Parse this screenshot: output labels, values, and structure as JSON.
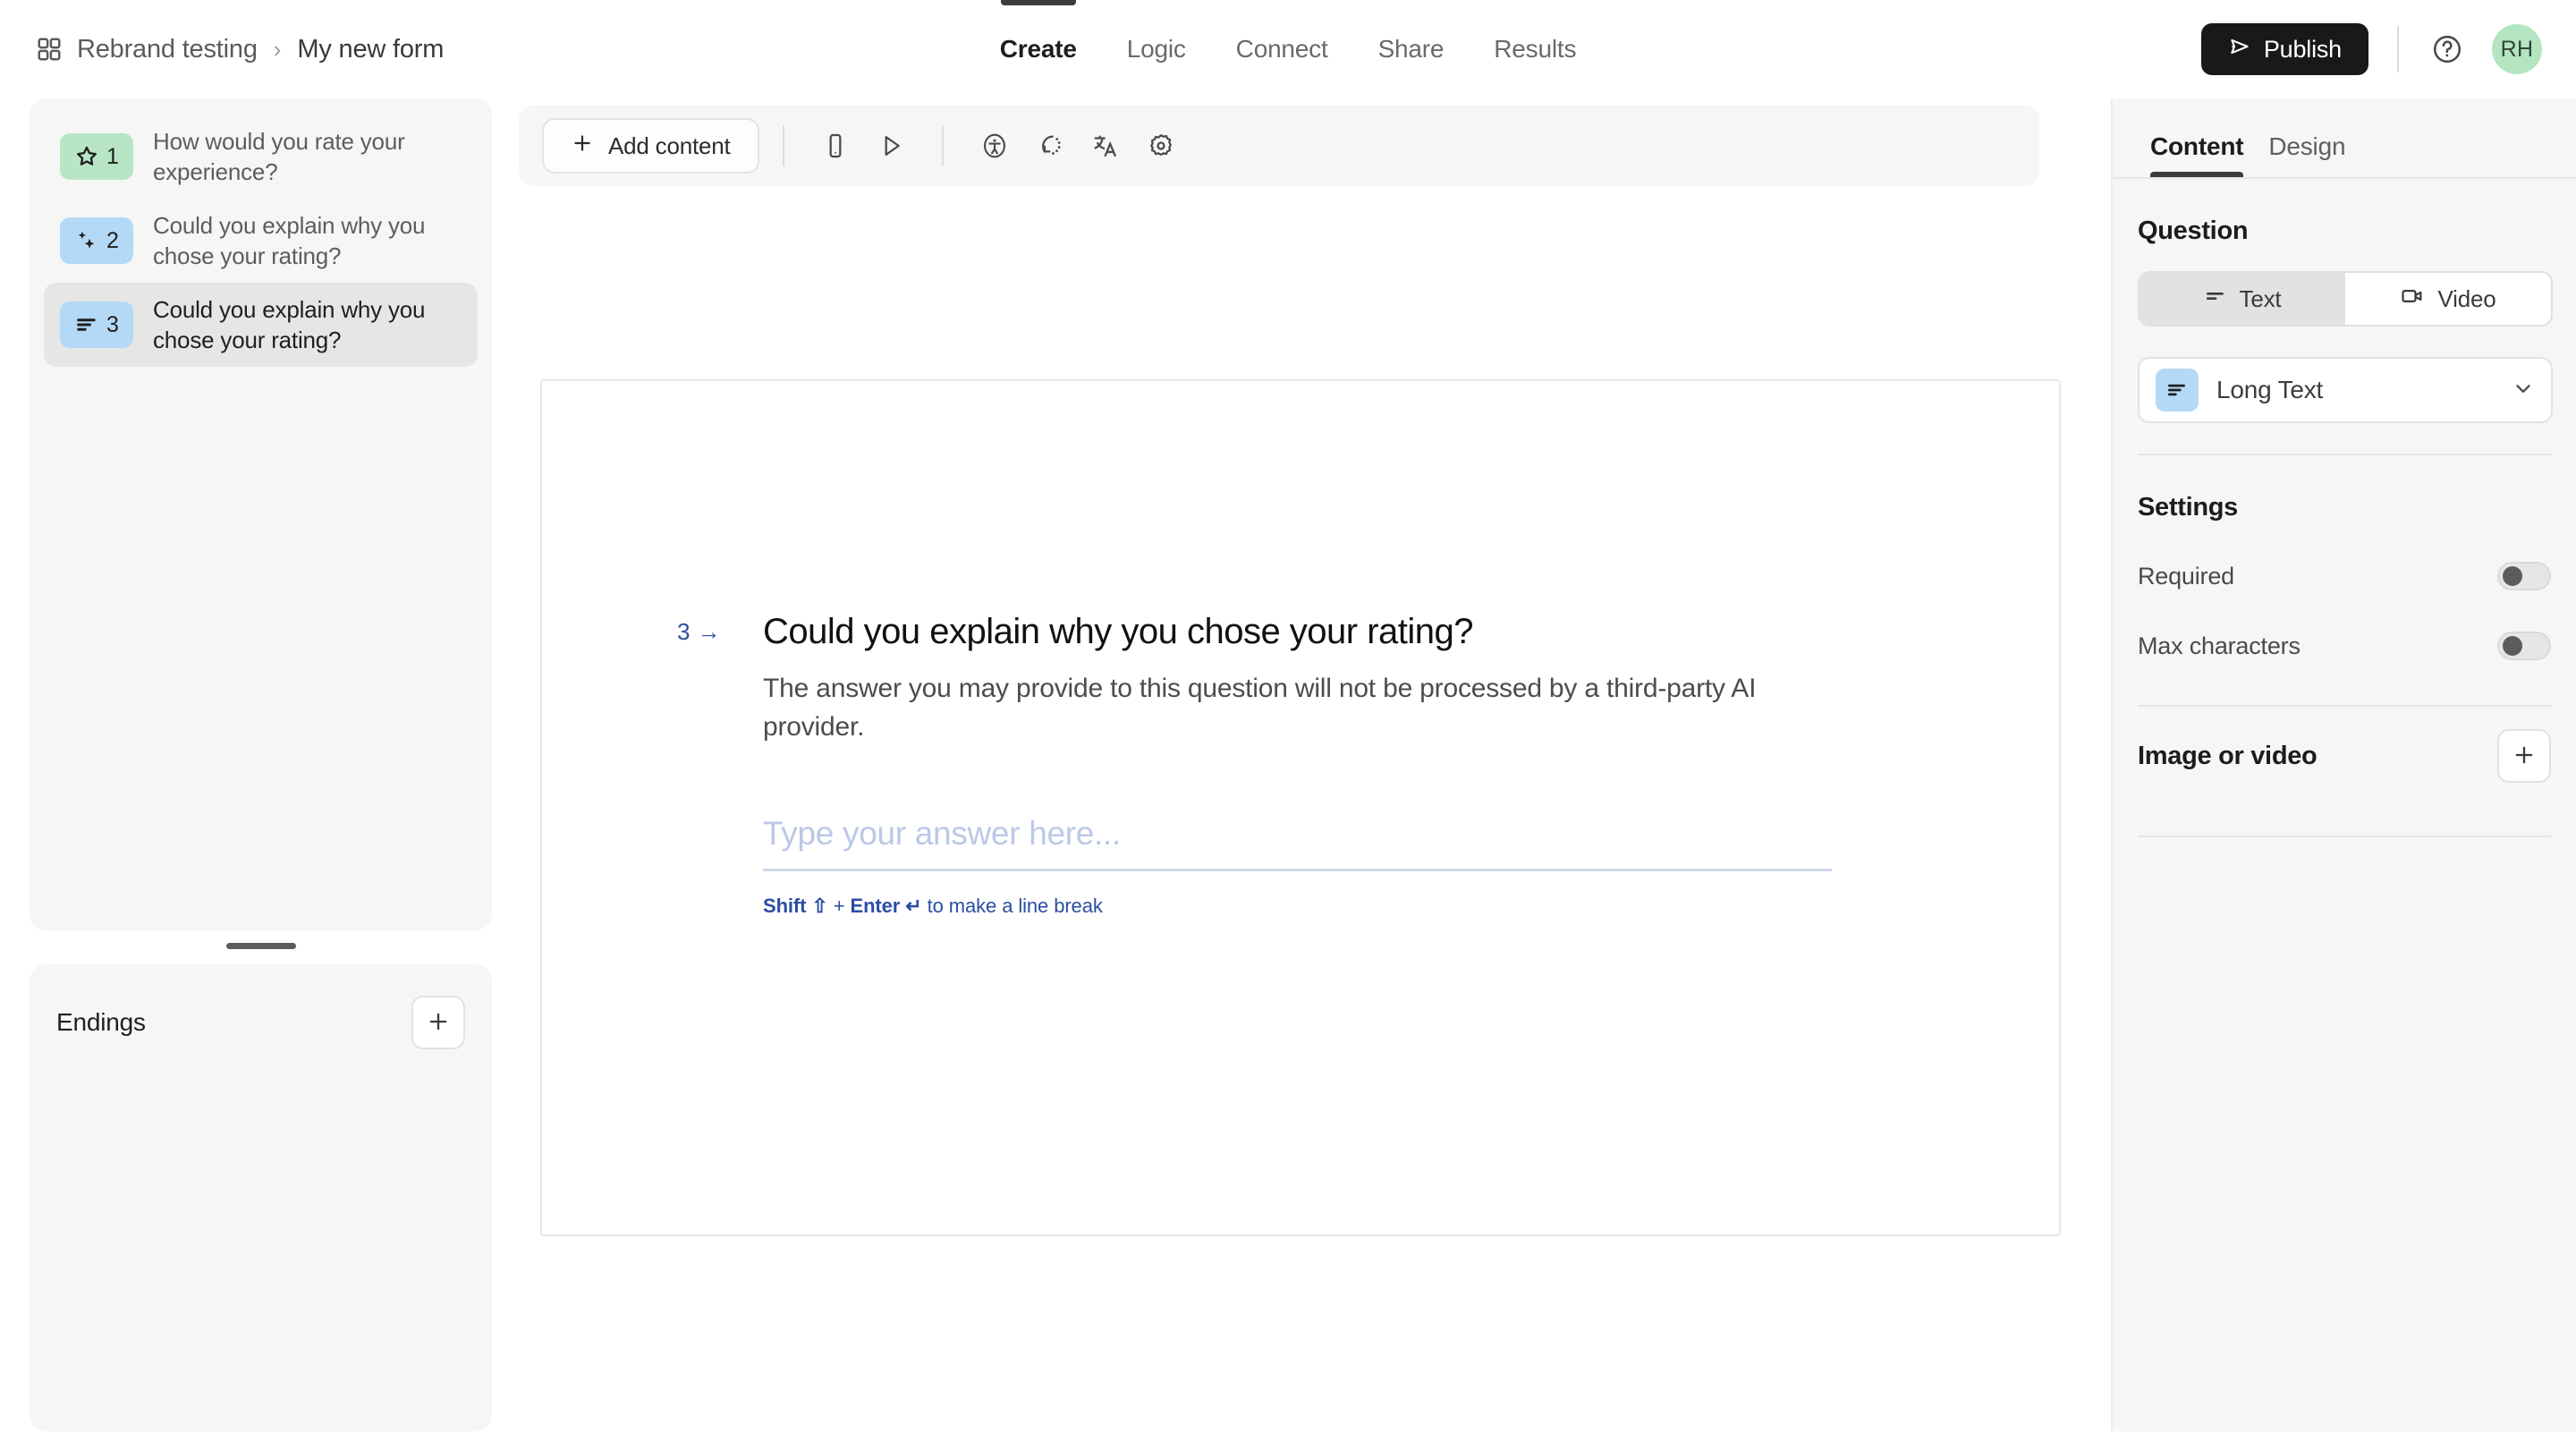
{
  "breadcrumb": {
    "icon": "grid-icon",
    "workspace": "Rebrand testing",
    "separator": "›",
    "form": "My new form"
  },
  "main_tabs": [
    {
      "label": "Create",
      "active": true
    },
    {
      "label": "Logic",
      "active": false
    },
    {
      "label": "Connect",
      "active": false
    },
    {
      "label": "Share",
      "active": false
    },
    {
      "label": "Results",
      "active": false
    }
  ],
  "topright": {
    "publish_label": "Publish",
    "publish_icon": "send-icon",
    "help_icon": "help-circle-icon",
    "avatar_initials": "RH",
    "avatar_color": "#b3e5c1"
  },
  "sidebar": {
    "questions": [
      {
        "number": "1",
        "label": "How would you rate your experience?",
        "icon": "star-icon",
        "badge_color": "#b8e6c4",
        "selected": false
      },
      {
        "number": "2",
        "label": "Could you explain why you chose your rating?",
        "icon": "sparkles-icon",
        "badge_color": "#b3d9f7",
        "selected": false
      },
      {
        "number": "3",
        "label": "Could you explain why you chose your rating?",
        "icon": "long-text-icon",
        "badge_color": "#b3d9f7",
        "selected": true
      }
    ],
    "endings": {
      "title": "Endings",
      "add_icon": "plus-icon"
    }
  },
  "toolbar": {
    "add_content_label": "Add content",
    "add_content_icon": "plus-icon",
    "buttons": [
      {
        "name": "mobile-preview-icon"
      },
      {
        "name": "play-preview-icon"
      },
      {
        "name": "accessibility-icon"
      },
      {
        "name": "recall-icon"
      },
      {
        "name": "translate-icon"
      },
      {
        "name": "settings-gear-icon"
      }
    ]
  },
  "canvas": {
    "question_number": "3",
    "question_arrow": "→",
    "title": "Could you explain why you chose your rating?",
    "description": "The answer you may provide to this question will not be processed by a third-party AI provider.",
    "answer_value": "",
    "answer_placeholder": "Type your answer here...",
    "hint_bold_1": "Shift ⇧",
    "hint_plus": " + ",
    "hint_bold_2": "Enter ↵",
    "hint_rest": " to make a line break",
    "accent_color": "#2b4ea2"
  },
  "right_panel": {
    "tabs": [
      {
        "label": "Content",
        "active": true
      },
      {
        "label": "Design",
        "active": false
      }
    ],
    "question_section_title": "Question",
    "media_type": [
      {
        "label": "Text",
        "icon": "text-lines-icon",
        "active": true
      },
      {
        "label": "Video",
        "icon": "video-camera-icon",
        "active": false
      }
    ],
    "type_select": {
      "label": "Long Text",
      "icon": "long-text-icon",
      "icon_color": "#b3d9f7",
      "chevron": "chevron-down-icon"
    },
    "settings_title": "Settings",
    "settings": [
      {
        "label": "Required",
        "enabled": false
      },
      {
        "label": "Max characters",
        "enabled": false
      }
    ],
    "image_or_video": {
      "label": "Image or video",
      "add_icon": "plus-icon"
    }
  }
}
